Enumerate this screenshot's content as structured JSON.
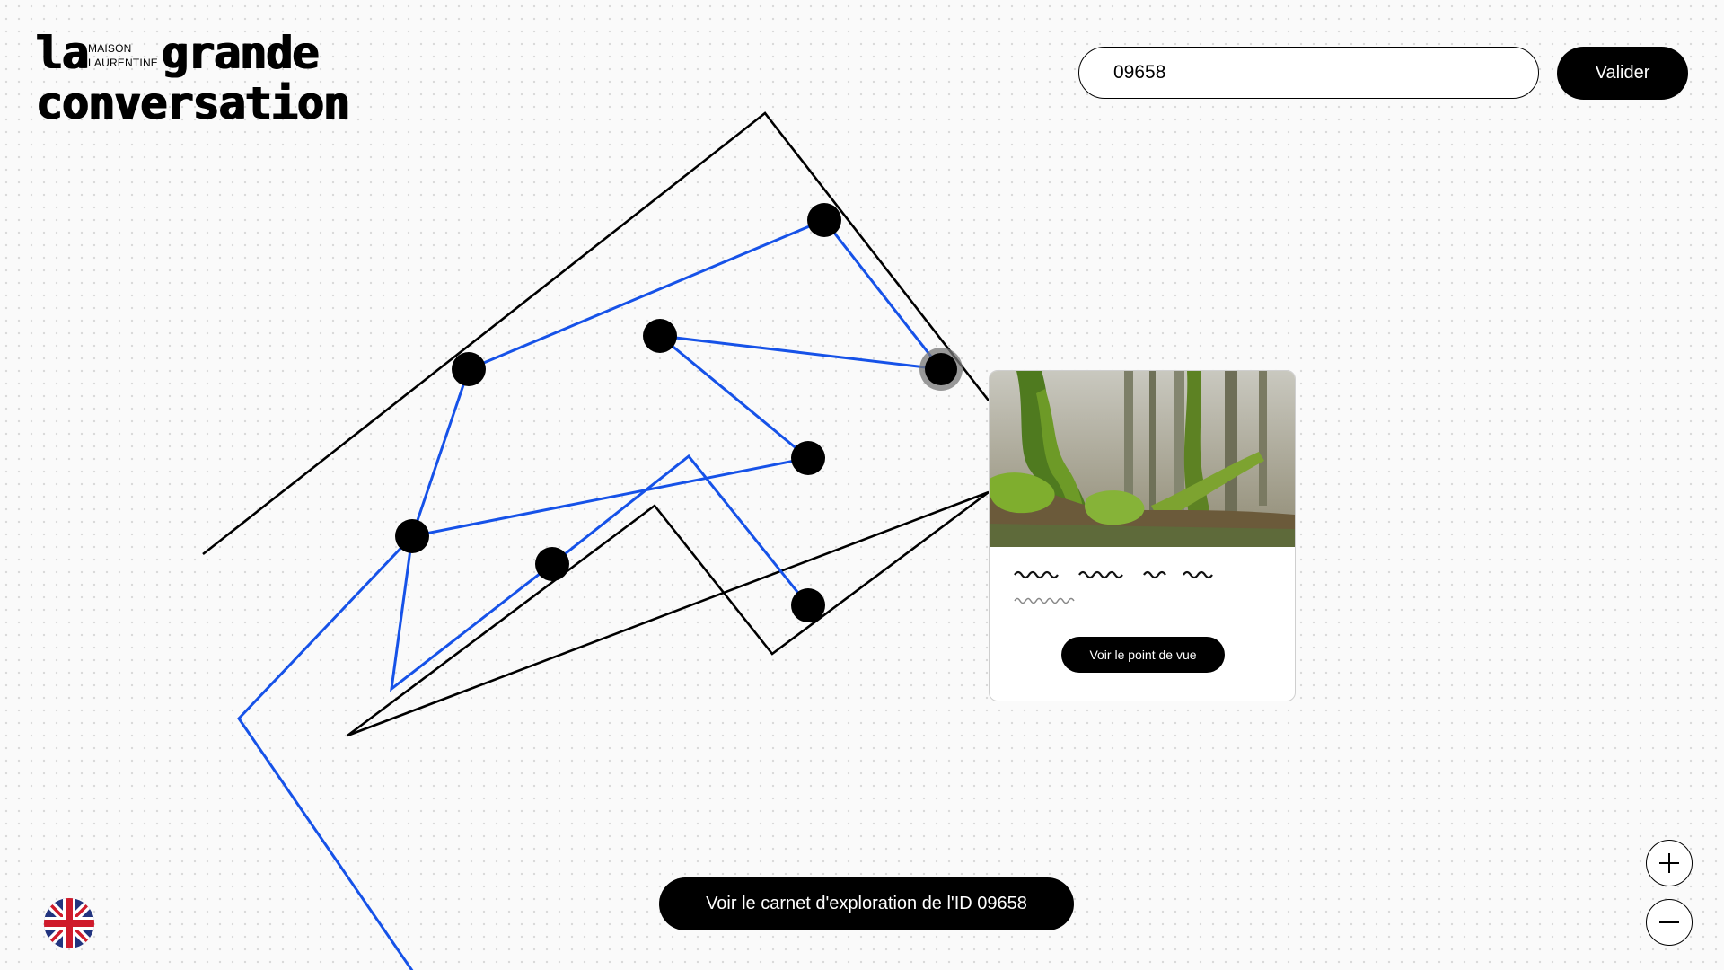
{
  "logo": {
    "word_la": "la",
    "word_grande": "grande",
    "word_conversation": "conversation",
    "maison": "MAISON",
    "laurentine": "LAURENTINE"
  },
  "search": {
    "value": "09658"
  },
  "validate_label": "Valider",
  "card": {
    "image_icon": "moss-forest-photo",
    "button_label": "Voir le point de vue"
  },
  "notebook_button_label": "Voir le carnet d'exploration de l'ID 09658",
  "zoom": {
    "in_icon": "plus-icon",
    "out_icon": "minus-icon"
  },
  "language_icon": "uk-flag-icon",
  "colors": {
    "accent_line": "#1652e8",
    "outline": "#000000",
    "background": "#fafafa"
  }
}
